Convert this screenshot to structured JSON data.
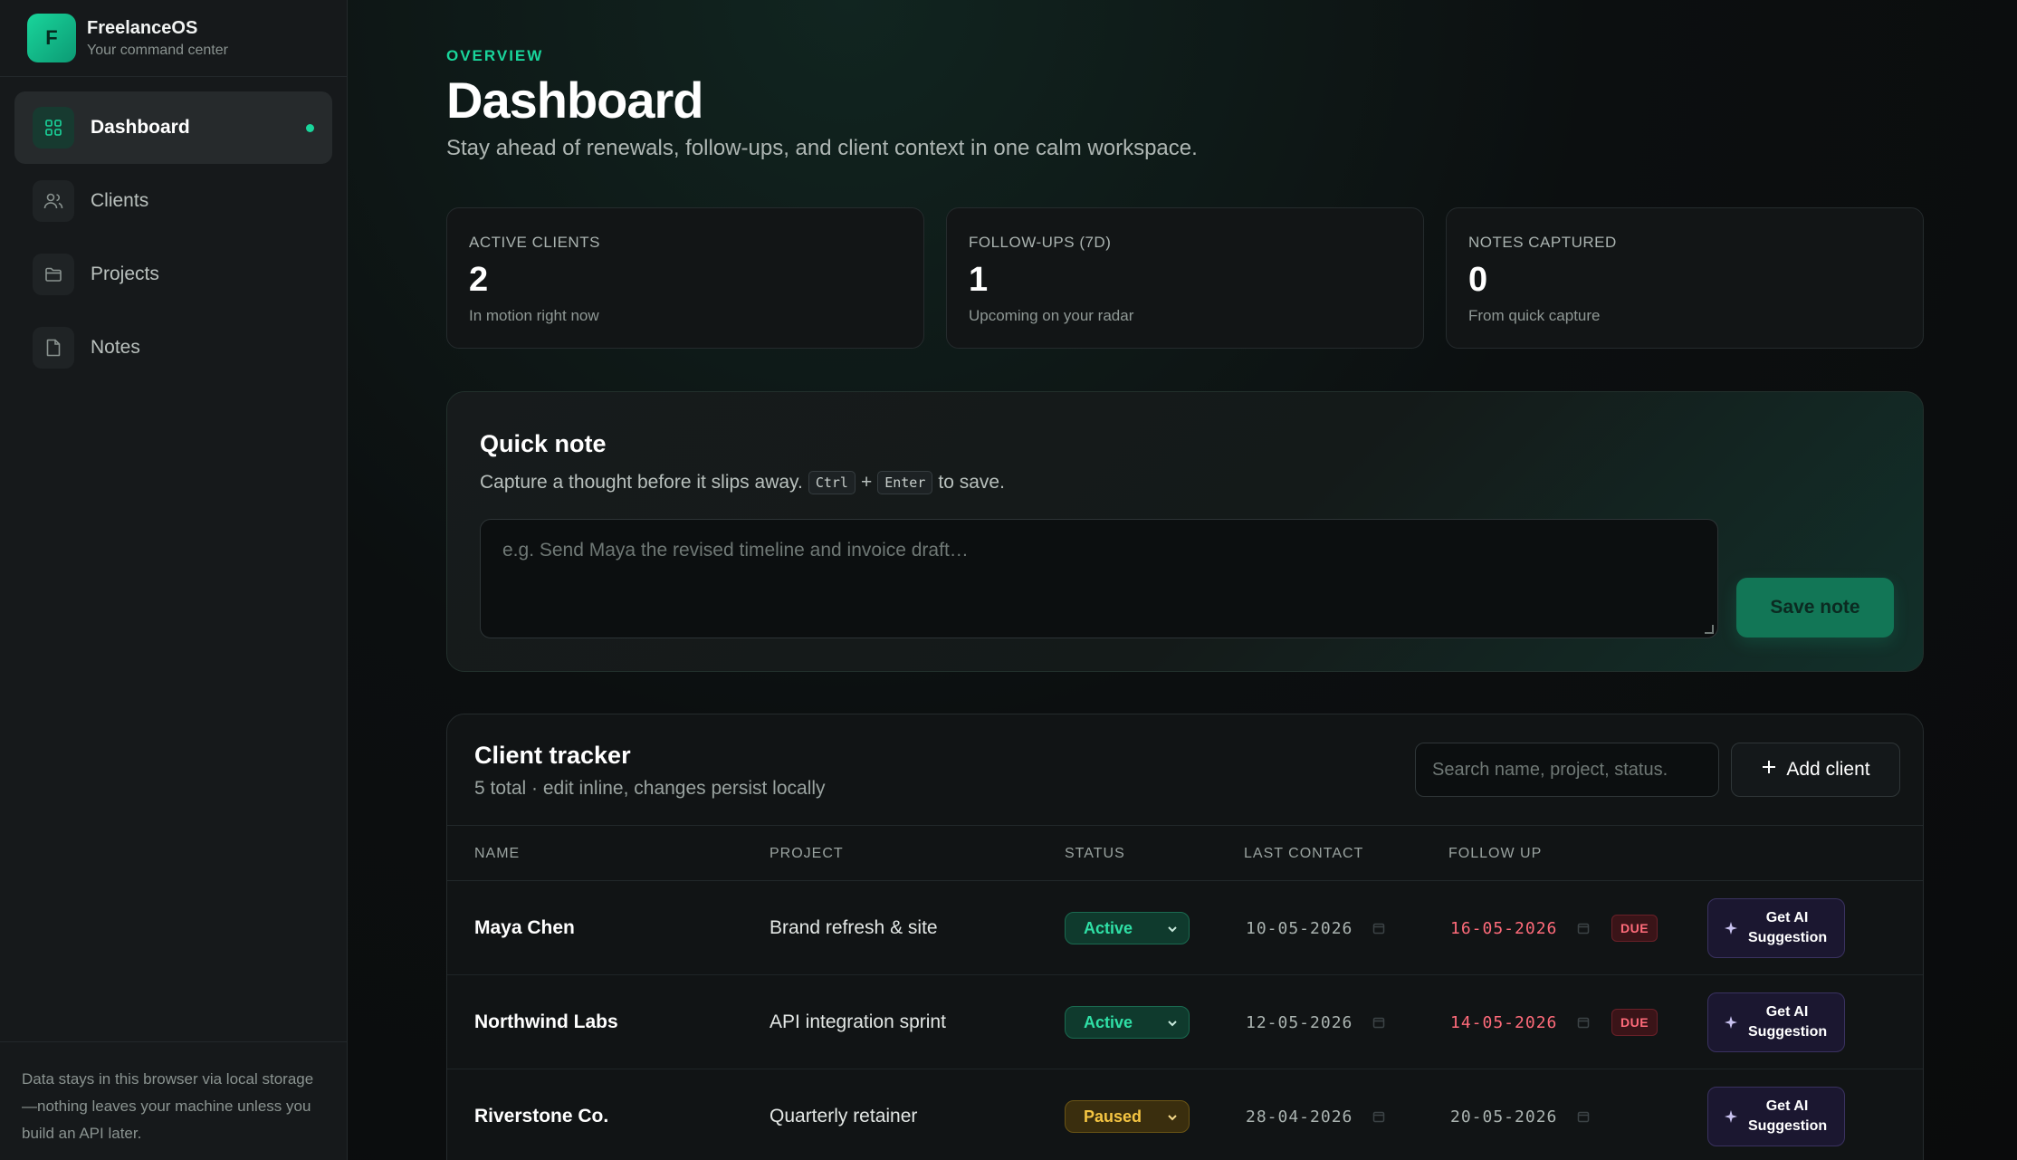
{
  "brand": {
    "logo_letter": "F",
    "name": "FreelanceOS",
    "tagline": "Your command center"
  },
  "sidebar": {
    "items": [
      {
        "label": "Dashboard",
        "icon": "grid-icon",
        "active": true
      },
      {
        "label": "Clients",
        "icon": "users-icon",
        "active": false
      },
      {
        "label": "Projects",
        "icon": "folder-icon",
        "active": false
      },
      {
        "label": "Notes",
        "icon": "file-icon",
        "active": false
      }
    ],
    "footer": "Data stays in this browser via local storage—nothing leaves your machine unless you build an API later."
  },
  "header": {
    "eyebrow": "OVERVIEW",
    "title": "Dashboard",
    "subtitle": "Stay ahead of renewals, follow-ups, and client context in one calm workspace."
  },
  "stats": [
    {
      "label": "ACTIVE CLIENTS",
      "value": "2",
      "hint": "In motion right now"
    },
    {
      "label": "FOLLOW-UPS (7D)",
      "value": "1",
      "hint": "Upcoming on your radar"
    },
    {
      "label": "NOTES CAPTURED",
      "value": "0",
      "hint": "From quick capture"
    }
  ],
  "quick_note": {
    "title": "Quick note",
    "subtitle_before": "Capture a thought before it slips away.",
    "key1": "Ctrl",
    "plus": "+",
    "key2": "Enter",
    "subtitle_after": "to save.",
    "placeholder": "e.g. Send Maya the revised timeline and invoice draft…",
    "save_label": "Save note"
  },
  "tracker": {
    "title": "Client tracker",
    "subtitle": "5 total · edit inline, changes persist locally",
    "search_placeholder": "Search name, project, status.",
    "add_label": "Add client",
    "columns": [
      "NAME",
      "PROJECT",
      "STATUS",
      "LAST CONTACT",
      "FOLLOW UP"
    ],
    "rows": [
      {
        "name": "Maya Chen",
        "project": "Brand refresh & site",
        "status": "Active",
        "last_contact": "10-05-2026",
        "follow_up": "16-05-2026",
        "due": "DUE",
        "ai_line1": "Get AI",
        "ai_line2": "Suggestion"
      },
      {
        "name": "Northwind Labs",
        "project": "API integration sprint",
        "status": "Active",
        "last_contact": "12-05-2026",
        "follow_up": "14-05-2026",
        "due": "DUE",
        "ai_line1": "Get AI",
        "ai_line2": "Suggestion"
      },
      {
        "name": "Riverstone Co.",
        "project": "Quarterly retainer",
        "status": "Paused",
        "last_contact": "28-04-2026",
        "follow_up": "20-05-2026",
        "due": "",
        "ai_line1": "Get AI",
        "ai_line2": "Suggestion"
      }
    ]
  },
  "colors": {
    "accent": "#19d59b",
    "danger": "#ff6b7a",
    "paused": "#f5c542"
  }
}
